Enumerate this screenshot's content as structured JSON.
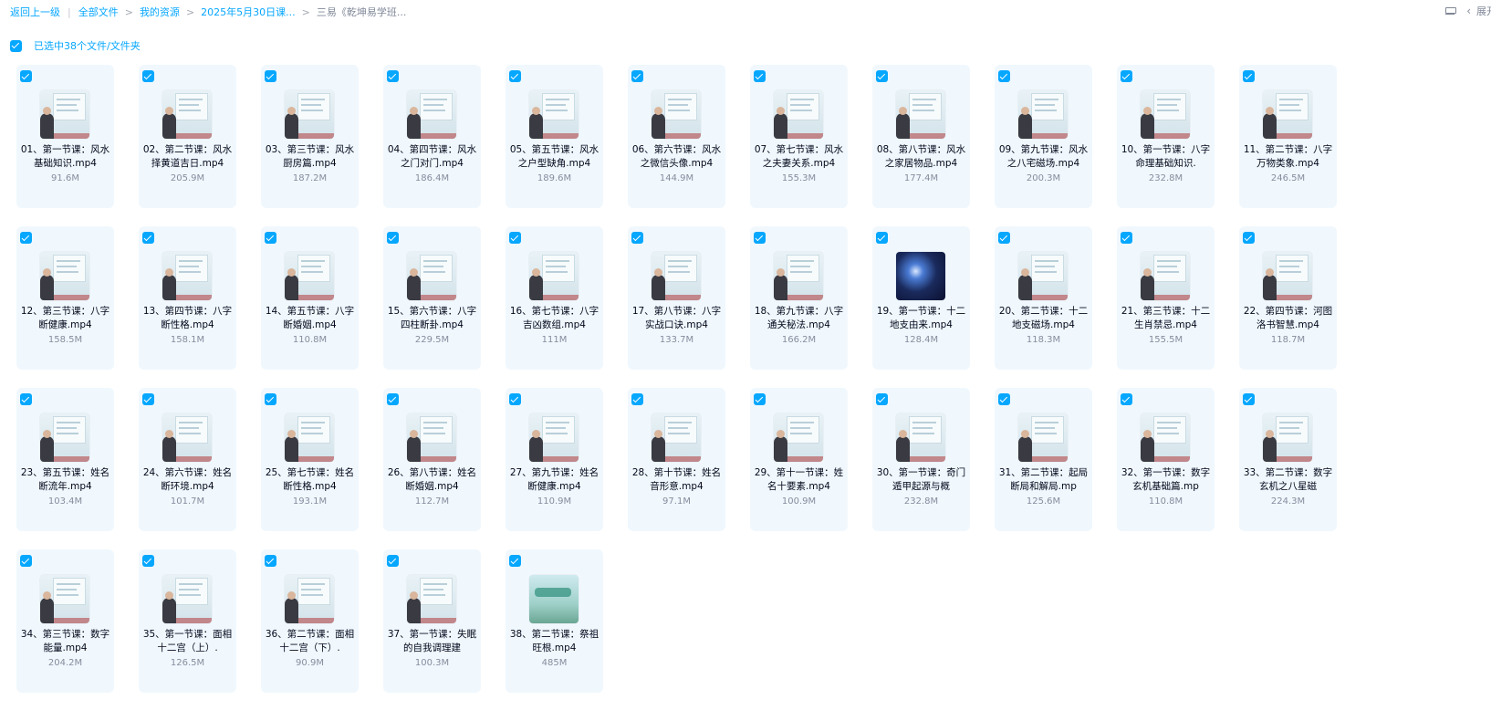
{
  "breadcrumb": {
    "back": "返回上一级",
    "items": [
      "全部文件",
      "我的资源",
      "2025年5月30日课...",
      "三易《乾坤易学班..."
    ]
  },
  "top_right": {
    "view_icon": "list-view-icon",
    "expand_label": "展开"
  },
  "selection": {
    "label": "已选中38个文件/文件夹",
    "checked": true
  },
  "accent_color": "#06a7ff",
  "files": [
    {
      "name": "01、第一节课：风水基础知识.mp4",
      "size": "91.6M"
    },
    {
      "name": "02、第二节课：风水择黄道吉日.mp4",
      "size": "205.9M"
    },
    {
      "name": "03、第三节课：风水厨房篇.mp4",
      "size": "187.2M"
    },
    {
      "name": "04、第四节课：风水之门对门.mp4",
      "size": "186.4M"
    },
    {
      "name": "05、第五节课：风水之户型缺角.mp4",
      "size": "189.6M"
    },
    {
      "name": "06、第六节课：风水之微信头像.mp4",
      "size": "144.9M"
    },
    {
      "name": "07、第七节课：风水之夫妻关系.mp4",
      "size": "155.3M"
    },
    {
      "name": "08、第八节课：风水之家居物品.mp4",
      "size": "177.4M"
    },
    {
      "name": "09、第九节课：风水之八宅磁场.mp4",
      "size": "200.3M"
    },
    {
      "name": "10、第一节课：八字命理基础知识.",
      "size": "232.8M"
    },
    {
      "name": "11、第二节课：八字万物类象.mp4",
      "size": "246.5M"
    },
    {
      "name": "12、第三节课：八字断健康.mp4",
      "size": "158.5M"
    },
    {
      "name": "13、第四节课：八字断性格.mp4",
      "size": "158.1M"
    },
    {
      "name": "14、第五节课：八字断婚姻.mp4",
      "size": "110.8M"
    },
    {
      "name": "15、第六节课：八字四柱断卦.mp4",
      "size": "229.5M"
    },
    {
      "name": "16、第七节课：八字吉凶数组.mp4",
      "size": "111M"
    },
    {
      "name": "17、第八节课：八字实战口诀.mp4",
      "size": "133.7M"
    },
    {
      "name": "18、第九节课：八字通关秘法.mp4",
      "size": "166.2M"
    },
    {
      "name": "19、第一节课：十二地支由来.mp4",
      "size": "128.4M",
      "thumb": "space"
    },
    {
      "name": "20、第二节课：十二地支磁场.mp4",
      "size": "118.3M"
    },
    {
      "name": "21、第三节课：十二生肖禁忌.mp4",
      "size": "155.5M"
    },
    {
      "name": "22、第四节课：河图洛书智慧.mp4",
      "size": "118.7M"
    },
    {
      "name": "23、第五节课：姓名断流年.mp4",
      "size": "103.4M"
    },
    {
      "name": "24、第六节课：姓名断环境.mp4",
      "size": "101.7M"
    },
    {
      "name": "25、第七节课：姓名断性格.mp4",
      "size": "193.1M"
    },
    {
      "name": "26、第八节课：姓名断婚姻.mp4",
      "size": "112.7M"
    },
    {
      "name": "27、第九节课：姓名断健康.mp4",
      "size": "110.9M"
    },
    {
      "name": "28、第十节课：姓名音形意.mp4",
      "size": "97.1M"
    },
    {
      "name": "29、第十一节课：姓名十要素.mp4",
      "size": "100.9M"
    },
    {
      "name": "30、第一节课：奇门遁甲起源与概",
      "size": "232.8M"
    },
    {
      "name": "31、第二节课：起局断局和解局.mp",
      "size": "125.6M"
    },
    {
      "name": "32、第一节课：数字玄机基础篇.mp",
      "size": "110.8M"
    },
    {
      "name": "33、第二节课：数字玄机之八星磁",
      "size": "224.3M"
    },
    {
      "name": "34、第三节课：数字能量.mp4",
      "size": "204.2M"
    },
    {
      "name": "35、第一节课：面相十二宫（上）.",
      "size": "126.5M"
    },
    {
      "name": "36、第二节课：面相十二宫（下）.",
      "size": "90.9M"
    },
    {
      "name": "37、第一节课：失眠的自我调理建",
      "size": "100.3M"
    },
    {
      "name": "38、第二节课：祭祖旺根.mp4",
      "size": "485M",
      "thumb": "cover"
    }
  ]
}
